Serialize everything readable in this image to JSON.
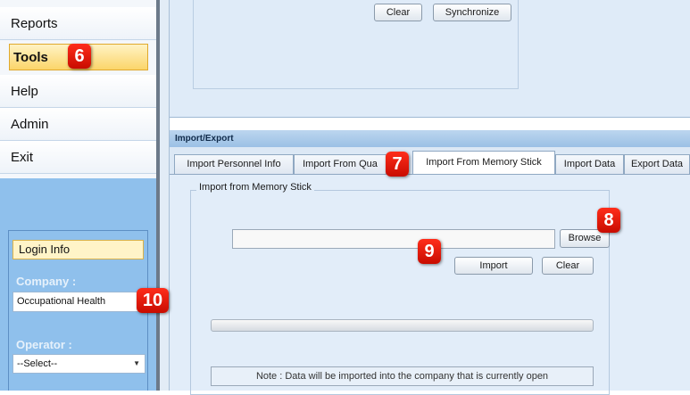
{
  "sidebar": {
    "nav": [
      {
        "label": "Reports"
      },
      {
        "label": "Tools"
      },
      {
        "label": "Help"
      },
      {
        "label": "Admin"
      },
      {
        "label": "Exit"
      }
    ],
    "login": {
      "header": "Login Info",
      "company_label": "Company :",
      "company_value": "Occupational Health",
      "operator_label": "Operator :",
      "operator_value": "--Select--"
    }
  },
  "top": {
    "clear_label": "Clear",
    "sync_label": "Synchronize"
  },
  "import_export": {
    "header": "Import/Export",
    "tabs": [
      {
        "label": "Import Personnel Info"
      },
      {
        "label": "Import From Qua"
      },
      {
        "label": "Import From Memory Stick",
        "selected": true
      },
      {
        "label": "Import Data"
      },
      {
        "label": "Export Data"
      }
    ],
    "group_title": "Import from Memory Stick",
    "path_value": "",
    "browse_label": "Browse",
    "import_label": "Import",
    "clear_label": "Clear",
    "progress": 0,
    "note": "Note : Data will be imported into the company that is currently open"
  },
  "callouts": [
    "6",
    "7",
    "8",
    "9",
    "10"
  ],
  "colors": {
    "callout": "#e01e0a",
    "active_nav": "#fbd56a",
    "sidebar_blue": "#8fc0ec",
    "panel_bg": "#e2edf9"
  }
}
